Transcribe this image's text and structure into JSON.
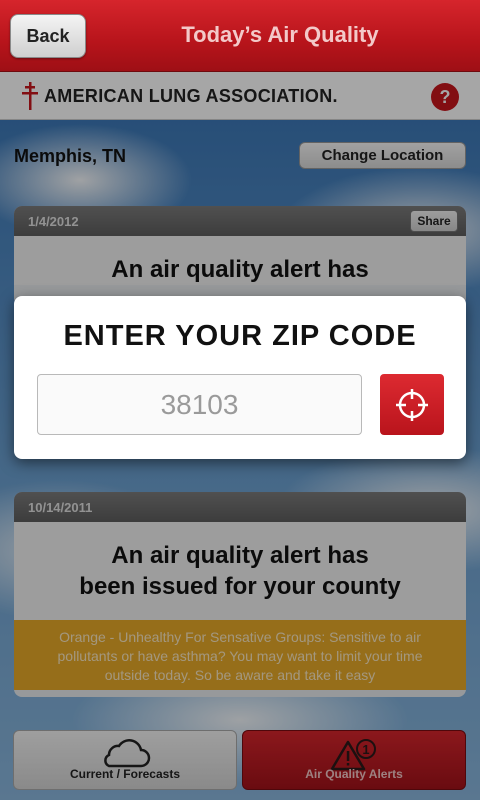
{
  "header": {
    "back_label": "Back",
    "title": "Today’s Air Quality"
  },
  "logo": {
    "text": "AMERICAN LUNG ASSOCIATION."
  },
  "help": {
    "label": "?"
  },
  "location": {
    "city": "Memphis, TN",
    "change_label": "Change Location"
  },
  "cards": [
    {
      "date": "1/4/2012",
      "share_label": "Share",
      "headline": "An air quality alert has"
    },
    {
      "date": "10/14/2011",
      "headline_line1": "An air quality alert has",
      "headline_line2": "been issued for your county",
      "note": "Orange - Unhealthy For Sensative Groups: Sensitive to air pollutants or have asthma? You may want to limit your time outside today. So be aware and take it easy"
    }
  ],
  "modal": {
    "title": "ENTER YOUR ZIP CODE",
    "zip_value": "38103"
  },
  "tabs": [
    {
      "label": "Current / Forecasts",
      "icon": "cloud-icon"
    },
    {
      "label": "Air Quality Alerts",
      "icon": "alert-triangle-icon",
      "badge": "1"
    }
  ],
  "colors": {
    "brand_red": "#c8161d",
    "note_orange": "#e6a928"
  }
}
